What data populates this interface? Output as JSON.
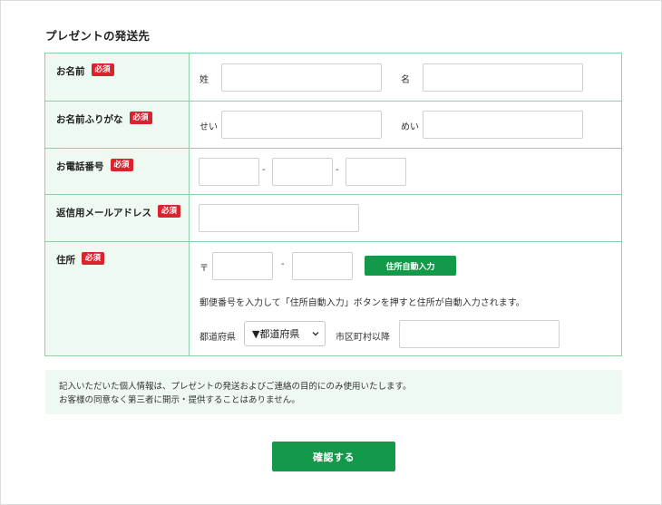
{
  "section_title": "プレゼントの発送先",
  "required_badge": "必須",
  "rows": {
    "name": {
      "label": "お名前",
      "last_label": "姓",
      "first_label": "名",
      "last_value": "",
      "first_value": ""
    },
    "kana": {
      "label": "お名前ふりがな",
      "last_label": "せい",
      "first_label": "めい",
      "last_value": "",
      "first_value": ""
    },
    "tel": {
      "label": "お電話番号",
      "separator": "-",
      "part1": "",
      "part2": "",
      "part3": ""
    },
    "mail": {
      "label": "返信用メールアドレス",
      "value": ""
    },
    "address": {
      "label": "住所",
      "postal_mark": "〒",
      "separator": "-",
      "zip1": "",
      "zip2": "",
      "auto_button": "住所自動入力",
      "help_text": "郵便番号を入力して「住所自動入力」ボタンを押すと住所が自動入力されます。",
      "prefecture_label": "都道府県",
      "prefecture_selected": "▼都道府県",
      "city_label": "市区町村以降",
      "city_value": ""
    }
  },
  "notice": {
    "line1": "記入いただいた個人情報は、プレゼントの発送およびご連絡の目的にのみ使用いたします。",
    "line2": "お客様の同意なく第三者に開示・提供することはありません。"
  },
  "confirm_button": "確認する",
  "colors": {
    "accent": "#13994a",
    "badge": "#d9232e",
    "label_bg": "#eefaf1",
    "border": "#8fd1a6"
  },
  "icons": {
    "select_caret": "chevron-down-icon"
  }
}
